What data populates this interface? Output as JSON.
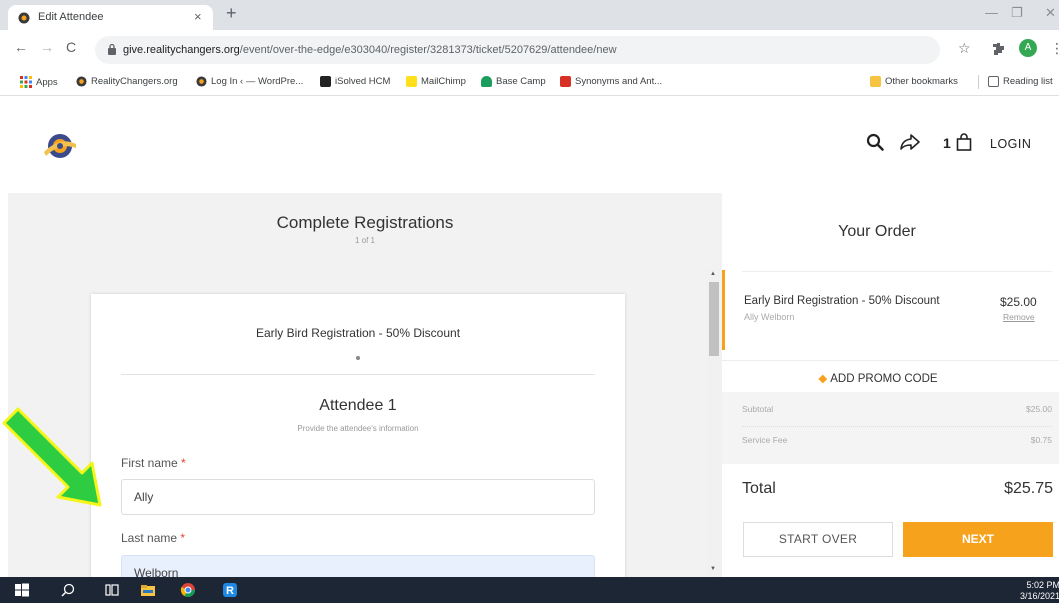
{
  "browser": {
    "tab_title": "Edit Attendee",
    "tab_close": "×",
    "new_tab": "+",
    "url_host": "give.realitychangers.org",
    "url_path": "/event/over-the-edge/e303040/register/3281373/ticket/5207629/attendee/new",
    "avatar_letter": "A",
    "bookmarks": [
      {
        "label": "Apps",
        "color": "#4285f4"
      },
      {
        "label": "RealityChangers.org",
        "color": "#333333"
      },
      {
        "label": "Log In ‹ — WordPre...",
        "color": "#555555"
      },
      {
        "label": "iSolved HCM",
        "color": "#222222"
      },
      {
        "label": "MailChimp",
        "color": "#ffe01b"
      },
      {
        "label": "Base Camp",
        "color": "#1d9d5c"
      },
      {
        "label": "Synonyms and Ant...",
        "color": "#d93025"
      }
    ],
    "other_bookmarks": "Other bookmarks",
    "reading_list": "Reading list"
  },
  "header": {
    "cart_count": "1",
    "login": "LOGIN"
  },
  "registration": {
    "title": "Complete Registrations",
    "progress": "1 of 1",
    "ticket_name": "Early Bird Registration - 50% Discount",
    "attendee_title": "Attendee 1",
    "attendee_subtitle": "Provide the attendee's information",
    "first_name_label": "First name",
    "first_name_value": "Ally",
    "last_name_label": "Last name",
    "last_name_value": "Welborn",
    "required_mark": "*"
  },
  "order": {
    "title": "Your Order",
    "item_name": "Early Bird Registration - 50% Discount",
    "item_attendee": "Ally Welborn",
    "item_price": "$25.00",
    "remove": "Remove",
    "promo": "ADD PROMO CODE",
    "subtotal_label": "Subtotal",
    "subtotal_value": "$25.00",
    "fee_label": "Service Fee",
    "fee_value": "$0.75",
    "total_label": "Total",
    "total_value": "$25.75",
    "start_over": "START OVER",
    "next": "NEXT"
  },
  "taskbar": {
    "time": "5:02 PM",
    "date": "3/16/2021"
  },
  "colors": {
    "accent": "#f7a21d",
    "arrow": "#2ecc40",
    "arrow_outline": "#f5f51a"
  }
}
